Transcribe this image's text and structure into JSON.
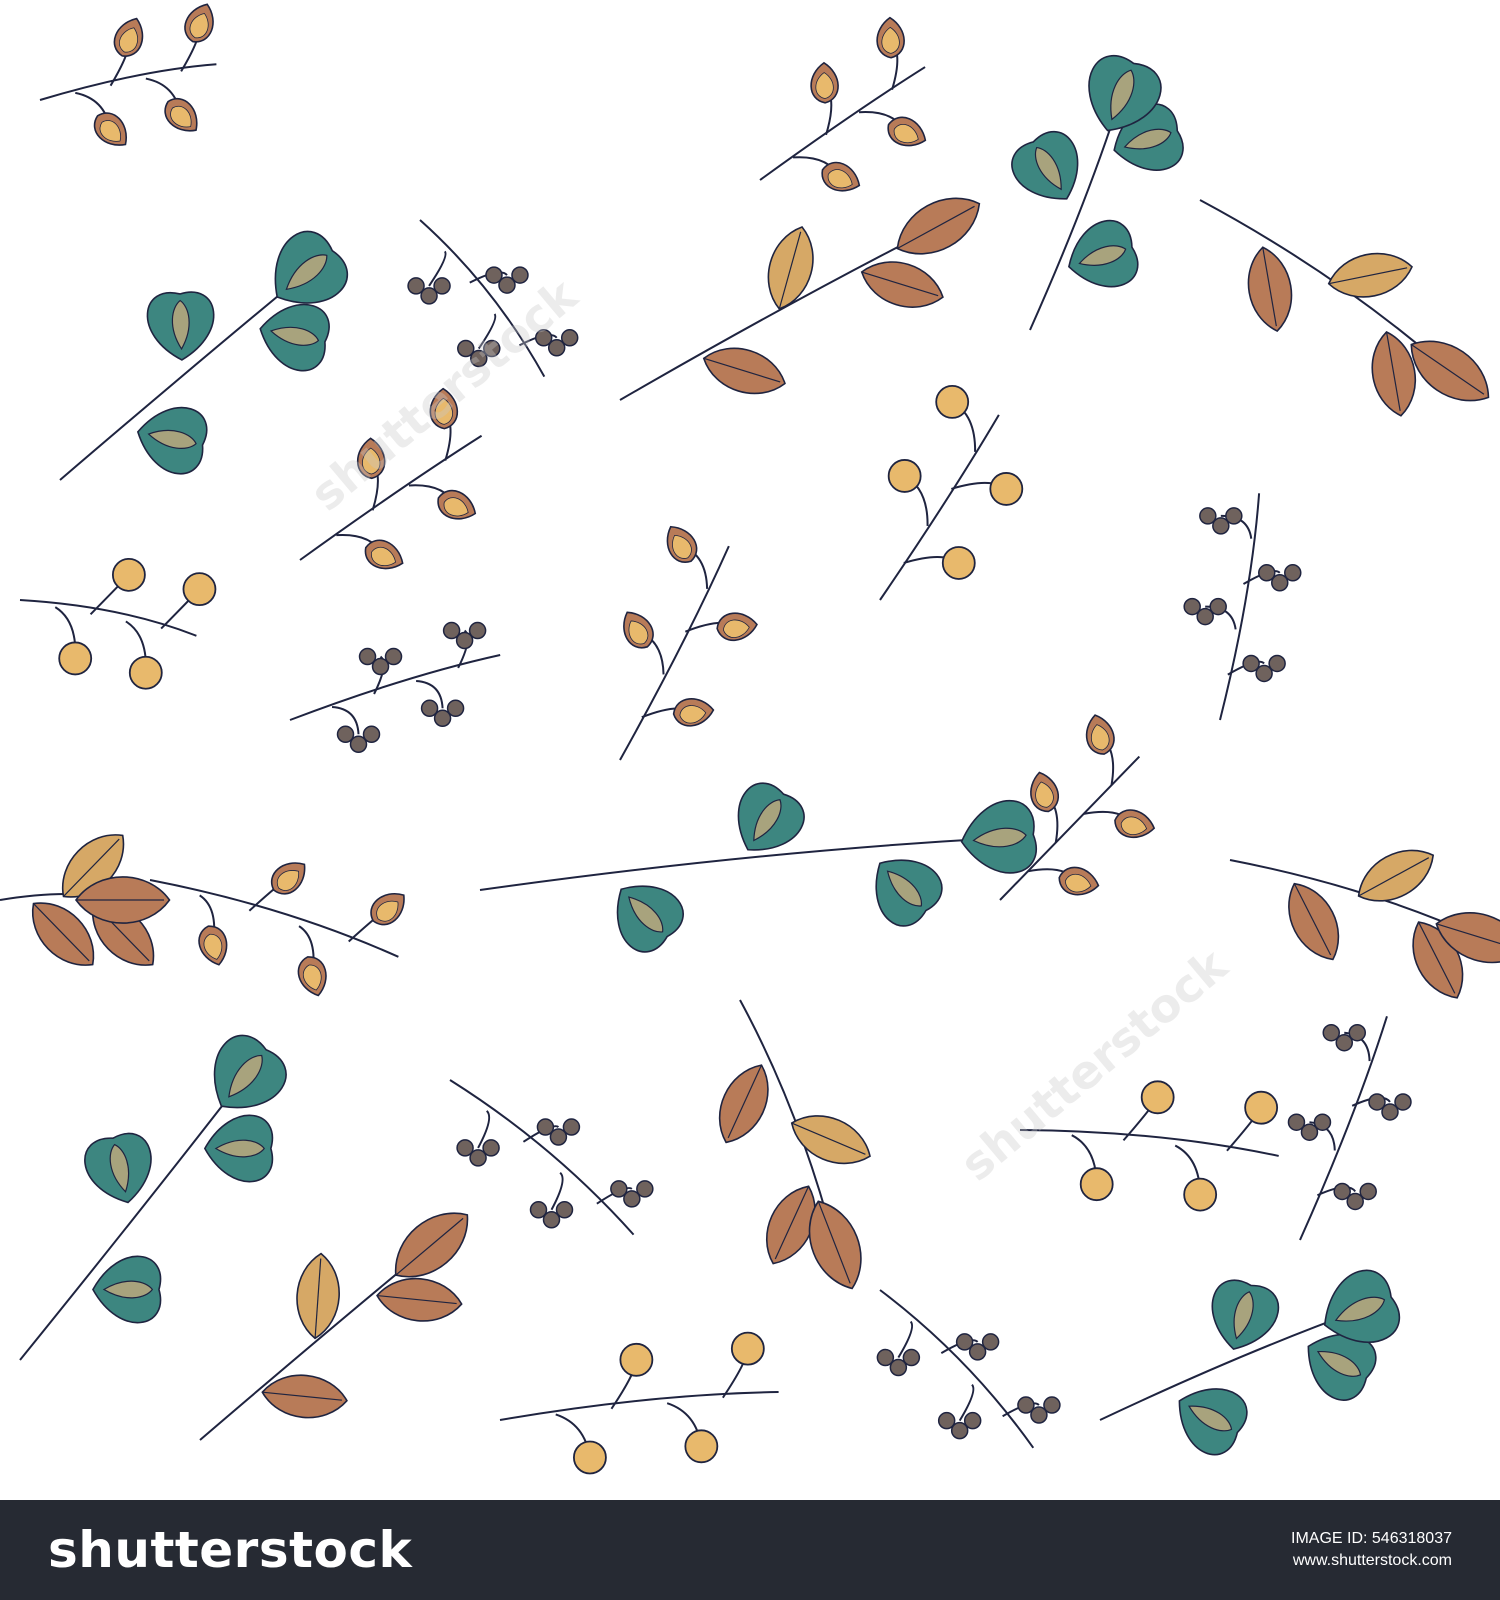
{
  "image": {
    "background": "#ffffff",
    "palette": {
      "teal": "#3d8680",
      "rust": "#b87b58",
      "tan": "#d6a866",
      "sand": "#e8b96c",
      "berry": "#6f625d",
      "stem": "#1f2440",
      "olive": "#a8a37d"
    }
  },
  "watermark": {
    "text": "shutterstock"
  },
  "footer": {
    "brand": "shutterstock",
    "image_id_label": "IMAGE ID:",
    "image_id": "546318037",
    "site": "www.shutterstock.com",
    "background": "#262a33"
  }
}
